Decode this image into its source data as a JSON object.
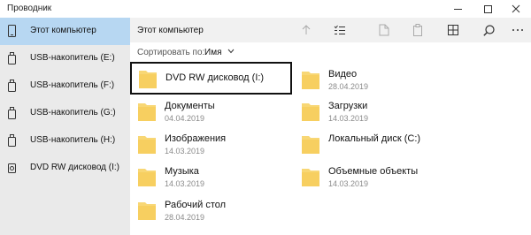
{
  "window": {
    "title": "Проводник"
  },
  "sidebar": {
    "items": [
      {
        "label": "Этот компьютер",
        "icon": "tablet-icon"
      },
      {
        "label": "USB-накопитель (E:)",
        "icon": "usb-drive-icon"
      },
      {
        "label": "USB-накопитель (F:)",
        "icon": "usb-drive-icon"
      },
      {
        "label": "USB-накопитель (G:)",
        "icon": "usb-drive-icon"
      },
      {
        "label": "USB-накопитель (H:)",
        "icon": "usb-drive-icon"
      },
      {
        "label": "DVD RW дисковод (I:)",
        "icon": "dvd-drive-icon"
      }
    ]
  },
  "header": {
    "location": "Этот компьютер",
    "toolbar": [
      "up-arrow-icon",
      "checklist-icon",
      "new-file-icon",
      "paste-icon",
      "view-grid-icon",
      "search-icon",
      "overflow-menu-icon"
    ]
  },
  "sort": {
    "prefix": "Сортировать по:",
    "value": "Имя"
  },
  "items": [
    {
      "name": "DVD RW дисковод (I:)",
      "date": ""
    },
    {
      "name": "Документы",
      "date": "04.04.2019"
    },
    {
      "name": "Изображения",
      "date": "14.03.2019"
    },
    {
      "name": "Музыка",
      "date": "14.03.2019"
    },
    {
      "name": "Рабочий стол",
      "date": "28.04.2019"
    },
    {
      "name": "Видео",
      "date": "28.04.2019"
    },
    {
      "name": "Загрузки",
      "date": "14.03.2019"
    },
    {
      "name": "Локальный диск (C:)",
      "date": ""
    },
    {
      "name": "Объемные объекты",
      "date": "14.03.2019"
    }
  ],
  "colors": {
    "sidebar_bg": "#eaeaea",
    "selected_bg": "#b7d7f2",
    "folder": "#f8d775",
    "toolbar_bg": "#f1f1f1"
  }
}
